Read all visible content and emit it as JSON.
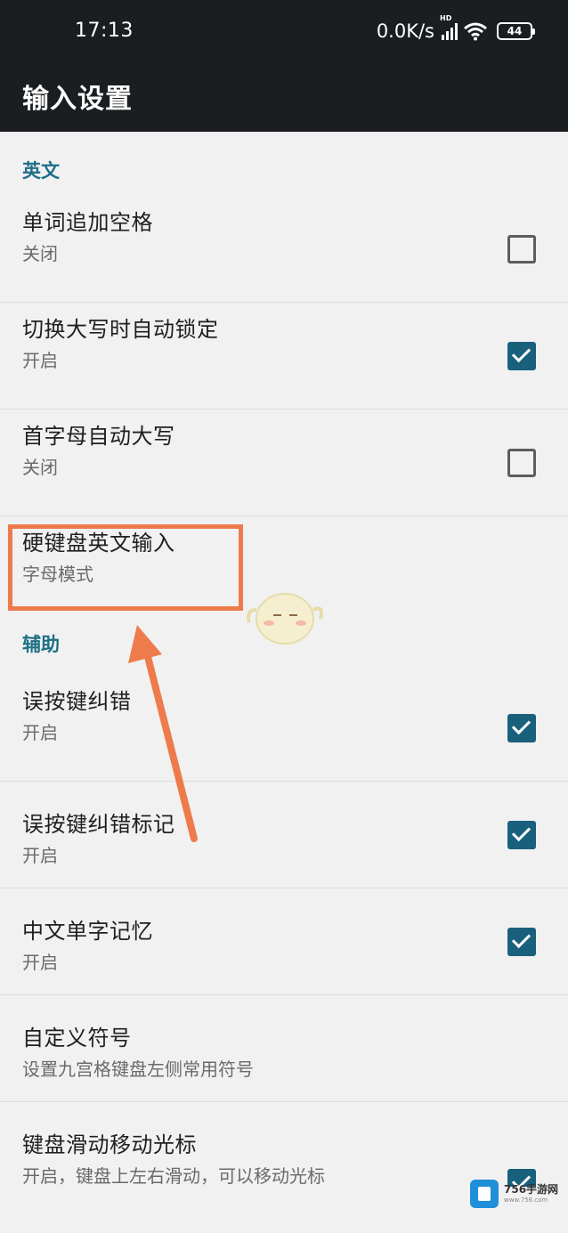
{
  "status_bar": {
    "time": "17:13",
    "net_speed": "0.0K/s",
    "network_badge": "HD",
    "battery": "44",
    "icons": [
      "signal-icon",
      "wifi-icon",
      "battery-icon"
    ]
  },
  "app_bar": {
    "title": "输入设置"
  },
  "sections": {
    "english": "英文",
    "assist": "辅助"
  },
  "items": [
    {
      "title": "单词追加空格",
      "subtitle": "关闭",
      "checked": false
    },
    {
      "title": "切换大写时自动锁定",
      "subtitle": "开启",
      "checked": true
    },
    {
      "title": "首字母自动大写",
      "subtitle": "关闭",
      "checked": false
    },
    {
      "title": "硬键盘英文输入",
      "subtitle": "字母模式"
    },
    {
      "title": "误按键纠错",
      "subtitle": "开启",
      "checked": true
    },
    {
      "title": "误按键纠错标记",
      "subtitle": "开启",
      "checked": true
    },
    {
      "title": "中文单字记忆",
      "subtitle": "开启",
      "checked": true
    },
    {
      "title": "自定义符号",
      "subtitle": "设置九宫格键盘左侧常用符号"
    },
    {
      "title": "键盘滑动移动光标",
      "subtitle": "开启，键盘上左右滑动，可以移动光标",
      "checked": true
    }
  ],
  "annotation": {
    "color": "#ee7b4c",
    "target": "硬键盘英文输入"
  },
  "watermark": {
    "name": "756手游网",
    "url": "www.756.com"
  },
  "colors": {
    "accent": "#19607c",
    "section_text": "#1d6e87",
    "bar": "#1b1e21",
    "background": "#f1f1f1"
  }
}
